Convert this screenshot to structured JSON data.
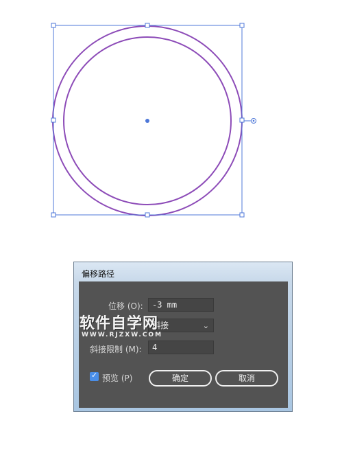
{
  "dialog": {
    "title": "偏移路径",
    "offset_label": "位移 (O):",
    "offset_value": "-3 mm",
    "joins_value": "斜接",
    "miter_label": "斜接限制 (M):",
    "miter_value": "4",
    "preview_label": "预览 (P)",
    "preview_checked": true,
    "ok_label": "确定",
    "cancel_label": "取消"
  },
  "watermark": {
    "text": "软件自学网",
    "subtext": "WWW.RJZXW.COM"
  },
  "colors": {
    "selection": "#4d77d8",
    "circle_stroke": "#8d4cb8",
    "dialog_bg": "#535353",
    "checkbox": "#4a8ee8"
  },
  "icons": {
    "chevron": "chevron-down-icon",
    "check": "check-icon"
  }
}
